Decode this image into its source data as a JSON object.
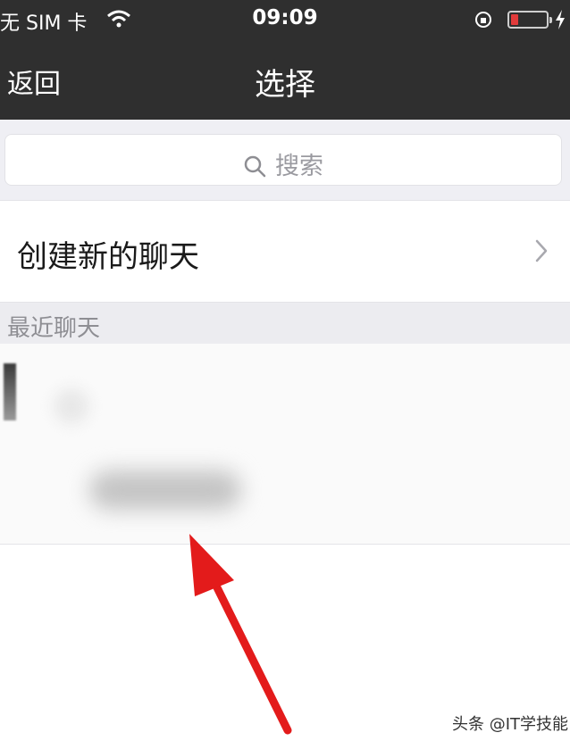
{
  "status_bar": {
    "carrier": "无 SIM 卡",
    "time": "09:09",
    "wifi_icon": "wifi-icon",
    "rotation_lock_icon": "rotation-lock-icon",
    "battery_icon": "battery-icon",
    "battery_level": 0.2,
    "charging_icon": "charging-icon"
  },
  "nav": {
    "back_label": "返回",
    "title": "选择"
  },
  "search": {
    "placeholder": "搜索",
    "icon": "search-icon"
  },
  "new_chat": {
    "label": "创建新的聊天",
    "icon": "chevron-right-icon"
  },
  "recent": {
    "header": "最近聊天"
  },
  "annotation": {
    "icon": "red-arrow-icon",
    "color": "#e31b1b"
  },
  "watermark": "头条 @IT学技能"
}
